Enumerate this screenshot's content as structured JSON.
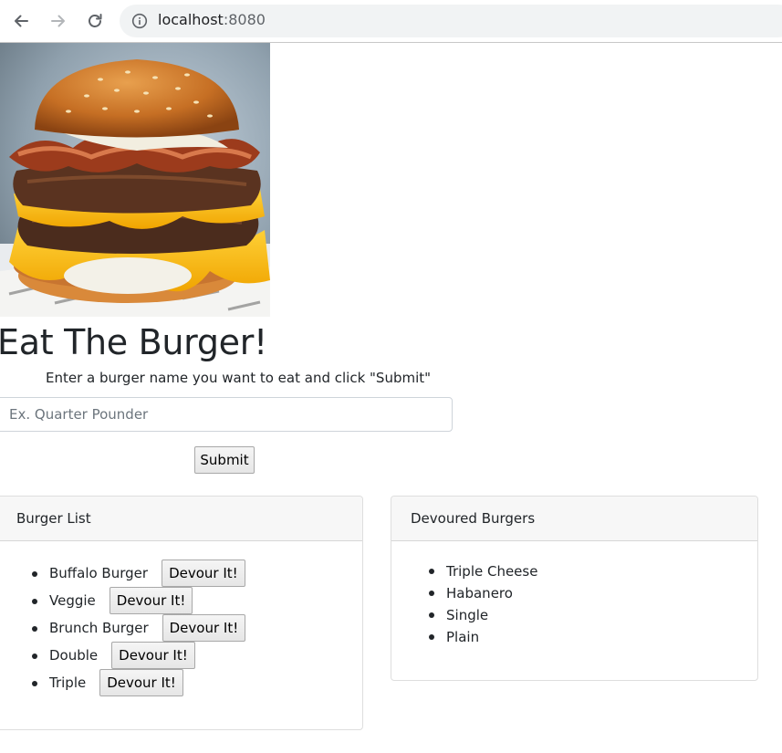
{
  "browser": {
    "url_host": "localhost",
    "url_port": ":8080",
    "icons": [
      "back-arrow-icon",
      "forward-arrow-icon",
      "reload-icon",
      "info-icon"
    ]
  },
  "hero": {
    "icon": "burger-photo"
  },
  "page": {
    "title": "Eat The Burger!",
    "instructions": "Enter a burger name you want to eat and click \"Submit\"",
    "input_placeholder": "Ex. Quarter Pounder",
    "input_value": "",
    "submit_label": "Submit"
  },
  "burger_list": {
    "header": "Burger List",
    "items": [
      {
        "name": "Buffalo Burger",
        "button": "Devour It!"
      },
      {
        "name": "Veggie",
        "button": "Devour It!"
      },
      {
        "name": "Brunch Burger",
        "button": "Devour It!"
      },
      {
        "name": "Double",
        "button": "Devour It!"
      },
      {
        "name": "Triple",
        "button": "Devour It!"
      }
    ]
  },
  "devoured": {
    "header": "Devoured Burgers",
    "items": [
      "Triple Cheese",
      "Habanero",
      "Single",
      "Plain"
    ]
  },
  "colors": {
    "omnibox_bg": "#f1f3f4",
    "card_header_bg": "#f7f7f7",
    "text": "#212529"
  }
}
